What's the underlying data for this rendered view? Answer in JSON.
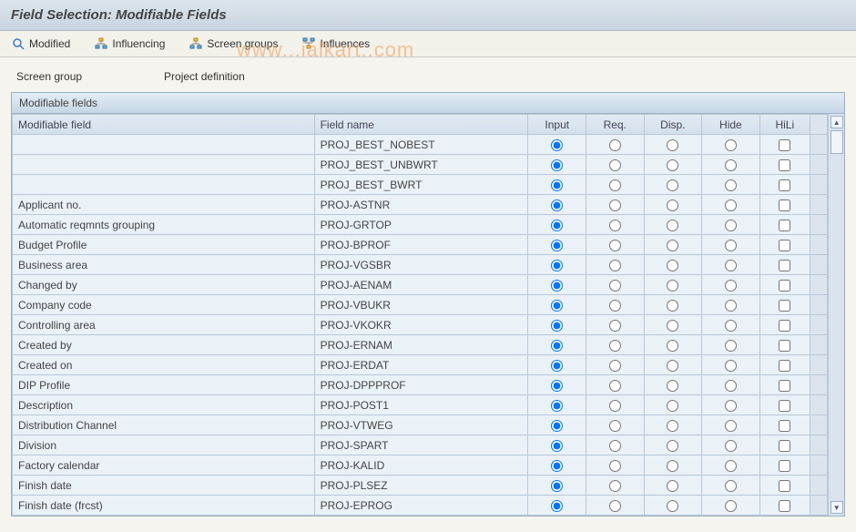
{
  "title": "Field Selection: Modifiable Fields",
  "toolbar": {
    "modified": "Modified",
    "influencing": "Influencing",
    "screen_groups": "Screen groups",
    "influences": "Influences"
  },
  "info": {
    "label": "Screen group",
    "value": "Project definition"
  },
  "panel_title": "Modifiable fields",
  "columns": {
    "modifiable": "Modifiable field",
    "field_name": "Field name",
    "input": "Input",
    "req": "Req.",
    "disp": "Disp.",
    "hide": "Hide",
    "hili": "HiLi"
  },
  "rows": [
    {
      "label": "",
      "name": "PROJ_BEST_NOBEST",
      "sel": "input"
    },
    {
      "label": "",
      "name": "PROJ_BEST_UNBWRT",
      "sel": "input"
    },
    {
      "label": "",
      "name": "PROJ_BEST_BWRT",
      "sel": "input"
    },
    {
      "label": "Applicant no.",
      "name": "PROJ-ASTNR",
      "sel": "input"
    },
    {
      "label": "Automatic reqmnts grouping",
      "name": "PROJ-GRTOP",
      "sel": "input"
    },
    {
      "label": "Budget Profile",
      "name": "PROJ-BPROF",
      "sel": "input"
    },
    {
      "label": "Business area",
      "name": "PROJ-VGSBR",
      "sel": "input"
    },
    {
      "label": "Changed by",
      "name": "PROJ-AENAM",
      "sel": "input"
    },
    {
      "label": "Company code",
      "name": "PROJ-VBUKR",
      "sel": "input"
    },
    {
      "label": "Controlling area",
      "name": "PROJ-VKOKR",
      "sel": "input"
    },
    {
      "label": "Created by",
      "name": "PROJ-ERNAM",
      "sel": "input"
    },
    {
      "label": "Created on",
      "name": "PROJ-ERDAT",
      "sel": "input"
    },
    {
      "label": "DIP Profile",
      "name": "PROJ-DPPPROF",
      "sel": "input"
    },
    {
      "label": "Description",
      "name": "PROJ-POST1",
      "sel": "input"
    },
    {
      "label": "Distribution Channel",
      "name": "PROJ-VTWEG",
      "sel": "input"
    },
    {
      "label": "Division",
      "name": "PROJ-SPART",
      "sel": "input"
    },
    {
      "label": "Factory calendar",
      "name": "PROJ-KALID",
      "sel": "input"
    },
    {
      "label": "Finish date",
      "name": "PROJ-PLSEZ",
      "sel": "input"
    },
    {
      "label": "Finish date (frcst)",
      "name": "PROJ-EPROG",
      "sel": "input"
    }
  ],
  "watermark": "www...ialkart..com"
}
